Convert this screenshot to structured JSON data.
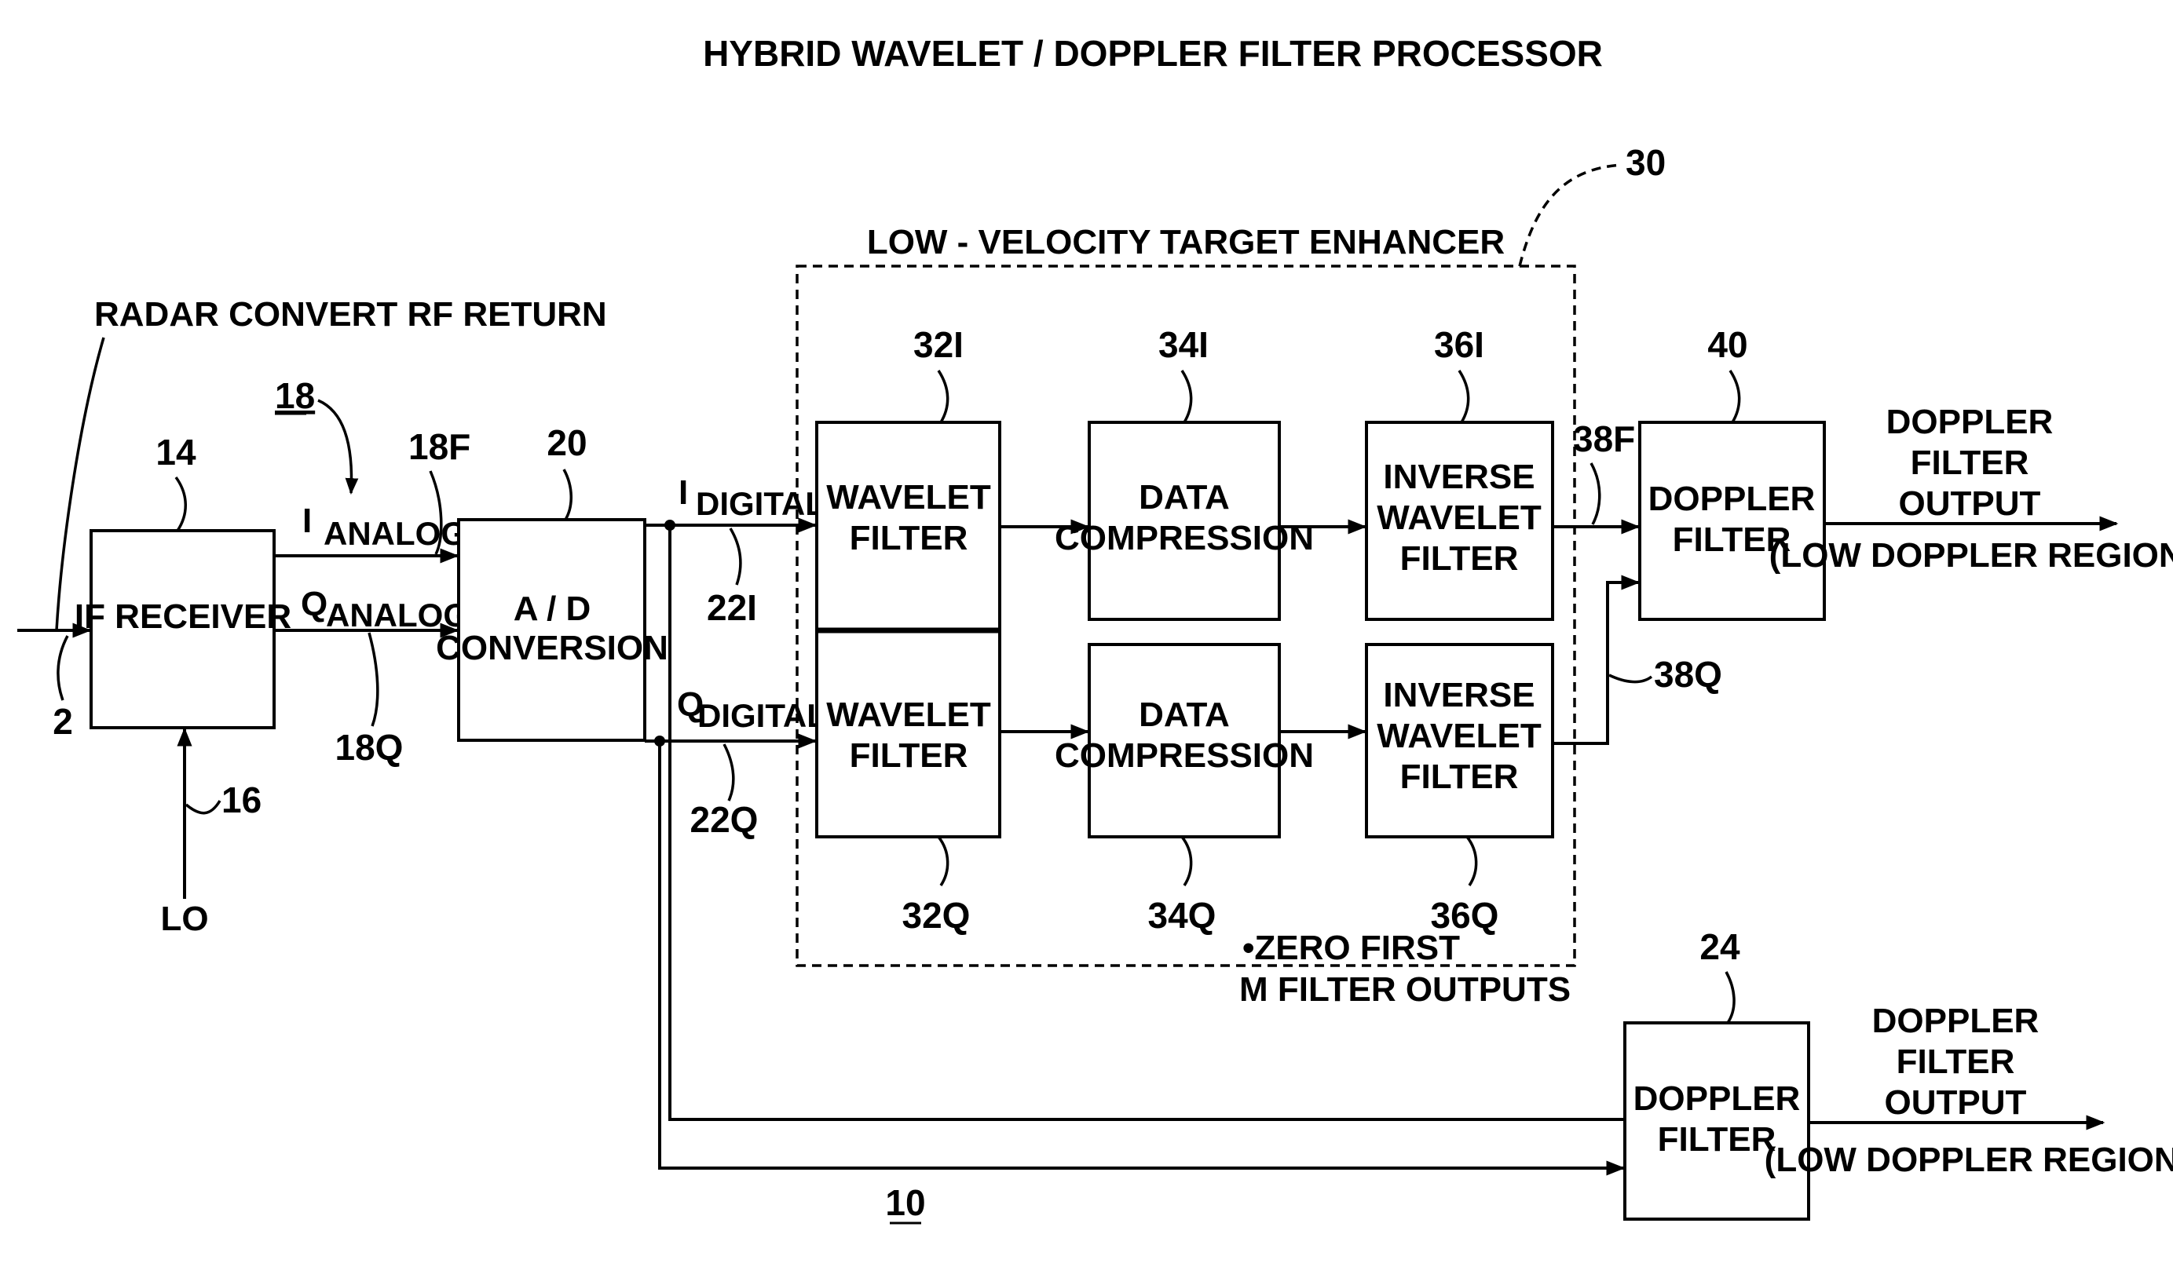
{
  "title": "HYBRID WAVELET / DOPPLER FILTER PROCESSOR",
  "input": {
    "label": "RADAR CONVERT RF RETURN",
    "ref": "2"
  },
  "if_receiver": {
    "label": "IF RECEIVER",
    "ref": "14"
  },
  "lo": {
    "label": "LO",
    "ref": "16"
  },
  "analog": {
    "group_ref": "18",
    "i_prefix": "I",
    "i_label": "ANALOG",
    "i_ref": "18F",
    "q_prefix": "Q",
    "q_label": "ANALOG",
    "q_ref": "18Q"
  },
  "ad": {
    "line1": "A / D",
    "line2": "CONVERSION",
    "ref": "20"
  },
  "digital": {
    "i_prefix": "I",
    "i_label": "DIGITAL",
    "i_ref": "22I",
    "q_prefix": "Q",
    "q_label": "DIGITAL",
    "q_ref": "22Q"
  },
  "enhancer": {
    "label": "LOW - VELOCITY TARGET ENHANCER",
    "ref": "30",
    "note_line1": "•ZERO FIRST",
    "note_line2": "M FILTER OUTPUTS",
    "wavelet_i": {
      "line1": "WAVELET",
      "line2": "FILTER",
      "ref": "32I"
    },
    "wavelet_q": {
      "line1": "WAVELET",
      "line2": "FILTER",
      "ref": "32Q"
    },
    "compression_i": {
      "line1": "DATA",
      "line2": "COMPRESSION",
      "ref": "34I"
    },
    "compression_q": {
      "line1": "DATA",
      "line2": "COMPRESSION",
      "ref": "34Q"
    },
    "inverse_i": {
      "line1": "INVERSE",
      "line2": "WAVELET",
      "line3": "FILTER",
      "ref": "36I"
    },
    "inverse_q": {
      "line1": "INVERSE",
      "line2": "WAVELET",
      "line3": "FILTER",
      "ref": "36Q"
    },
    "out_i_ref": "38F",
    "out_q_ref": "38Q"
  },
  "doppler_top": {
    "line1": "DOPPLER",
    "line2": "FILTER",
    "ref": "40",
    "output_line1": "DOPPLER",
    "output_line2": "FILTER",
    "output_line3": "OUTPUT",
    "output_region": "(LOW DOPPLER REGION)"
  },
  "doppler_bottom": {
    "line1": "DOPPLER",
    "line2": "FILTER",
    "ref": "24",
    "output_line1": "DOPPLER",
    "output_line2": "FILTER",
    "output_line3": "OUTPUT",
    "output_region": "(LOW DOPPLER REGION)"
  },
  "system_ref": "10"
}
